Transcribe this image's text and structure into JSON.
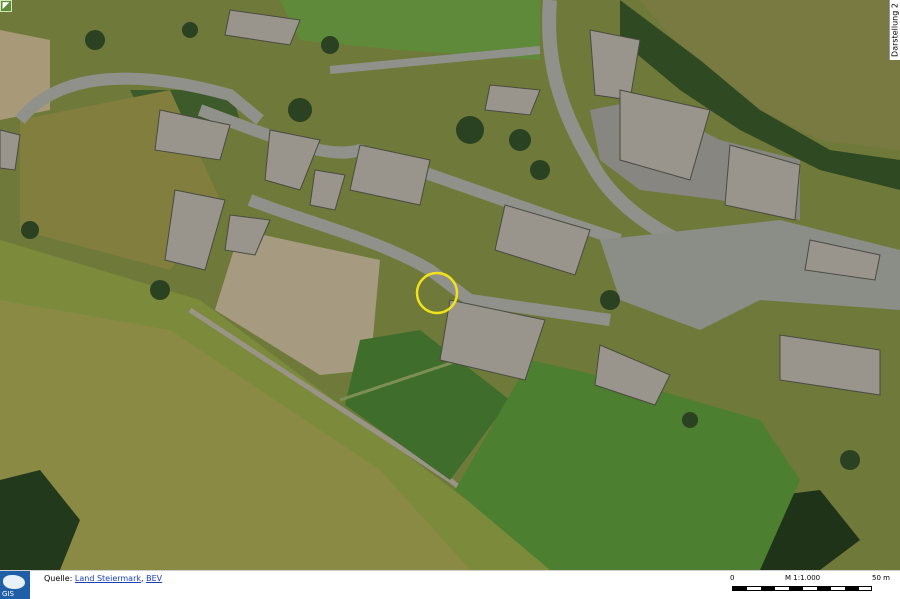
{
  "map": {
    "kind": "aerial orthophoto",
    "marker": {
      "shape": "circle",
      "color": "#f2e21c"
    },
    "side_label": "Darstellung 2"
  },
  "footer": {
    "logo_text": "GIS",
    "source_prefix": "Quelle:",
    "source_link_1": "Land Steiermark",
    "source_separator": ",",
    "source_link_2": "BEV",
    "scale_start": "0",
    "scale_ratio": "M 1:1.000",
    "scale_end": "50 m"
  },
  "colors": {
    "meadow": "#6f7a3a",
    "road": "#8f918a",
    "roof": "#9a958c",
    "sports_field": "#3f6e2c",
    "marker": "#f2e21c"
  }
}
